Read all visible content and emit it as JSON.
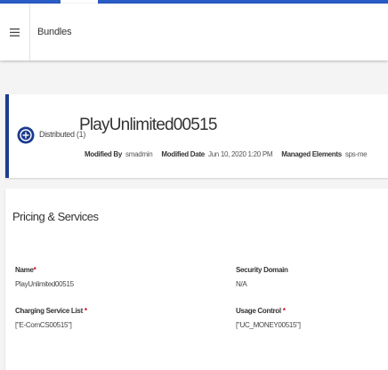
{
  "header": {
    "title": "Bundles",
    "menu_icon": "hamburger-menu-icon"
  },
  "colors": {
    "topbar": "#2a5cc5",
    "accent": "#1d3b8f",
    "required": "#d0021b"
  },
  "bundle": {
    "name": "PlayUnlimited00515",
    "status_icon": "plus-circle-icon",
    "status": "Distributed",
    "status_count": "(1)",
    "meta": {
      "modified_by_label": "Modified By",
      "modified_by": "smadmin",
      "modified_date_label": "Modified Date",
      "modified_date": "Jun 10, 2020 1:20 PM",
      "managed_elements_label": "Managed Elements",
      "managed_elements": "sps-me"
    }
  },
  "details": {
    "section_title": "Pricing & Services",
    "name_label": "Name",
    "name_value": "PlayUnlimited00515",
    "security_domain_label": "Security Domain",
    "security_domain_value": "N/A",
    "charging_label": "Charging Service List",
    "charging_value": "[\"E-ComCS00515\"]",
    "usage_label": "Usage Control",
    "usage_value": "[\"UC_MONEY00515\"]",
    "required_marker": "*"
  }
}
